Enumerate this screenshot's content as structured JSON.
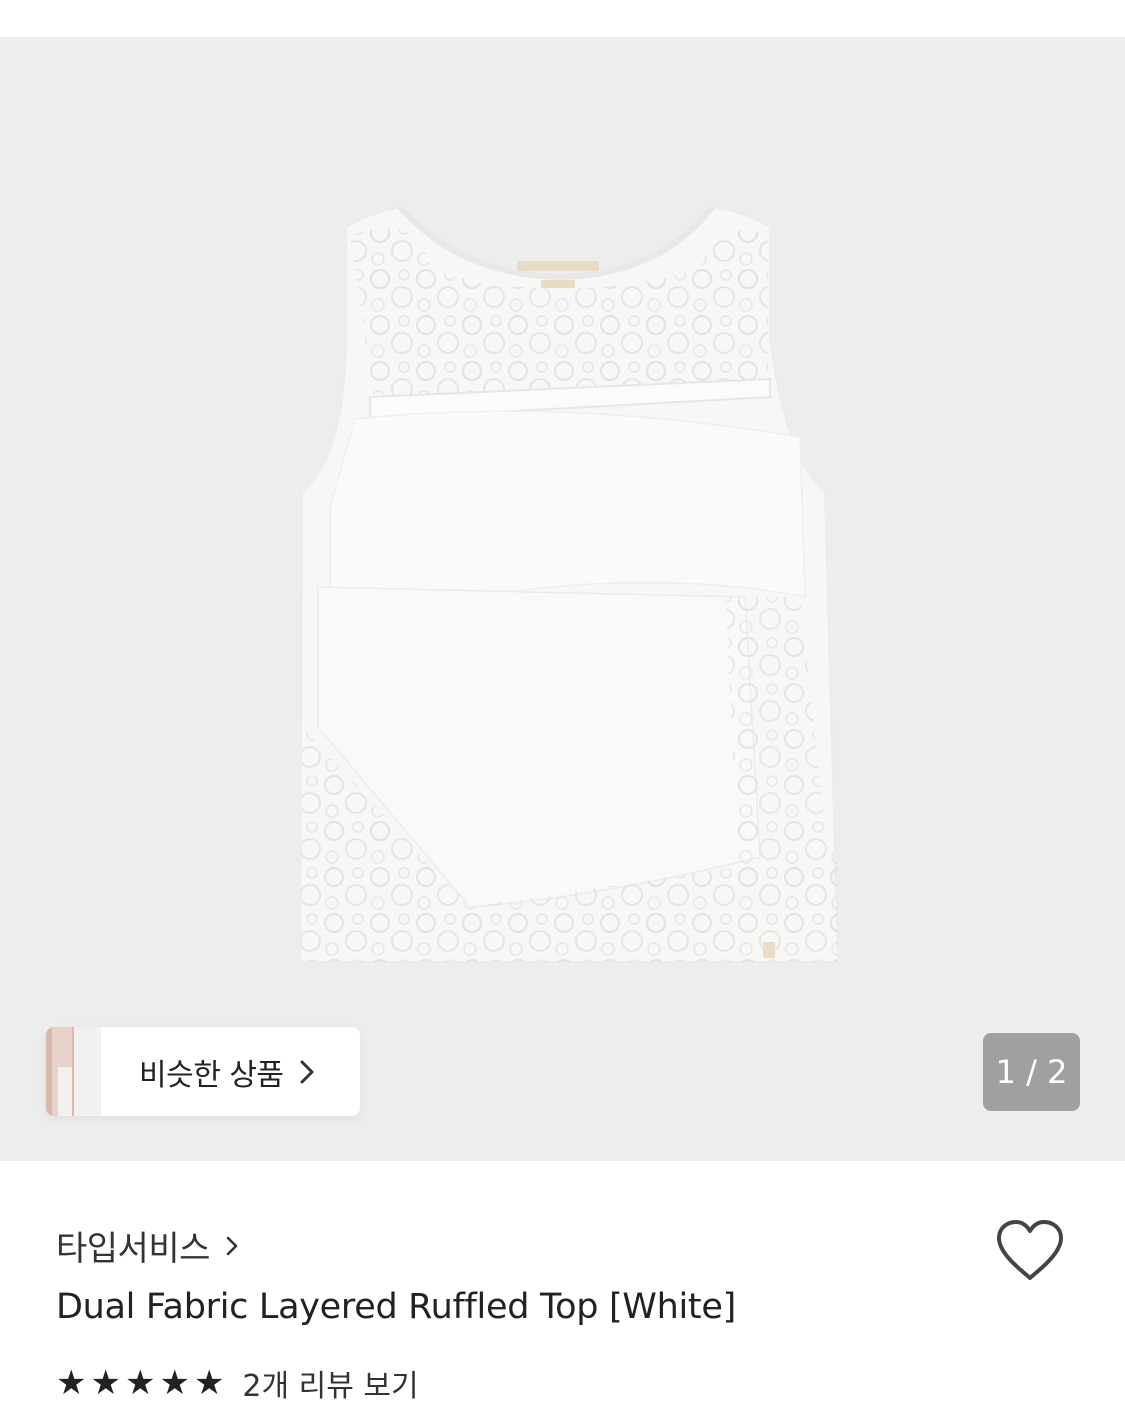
{
  "gallery": {
    "background": "#ededed",
    "similar_products_label": "비슷한 상품",
    "page_counter": "1 / 2"
  },
  "product": {
    "brand": "타입서비스",
    "title": "Dual Fabric Layered Ruffled Top [White]",
    "review_link": "2개 리뷰 보기",
    "stars": [
      "★",
      "★",
      "★",
      "★",
      "★"
    ]
  },
  "icons": {
    "brand_chevron": "chevron-right-icon",
    "similar_chevron": "chevron-right-icon",
    "wishlist": "heart-outline-icon"
  }
}
